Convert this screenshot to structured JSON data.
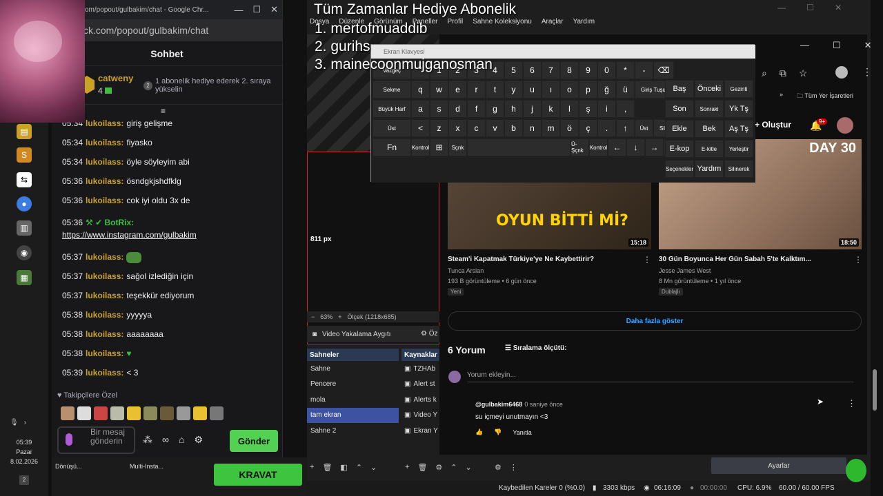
{
  "overlay": {
    "title": "Tüm Zamanlar Hediye  Abonelik",
    "lines": [
      "1. mertofmuaddib",
      "2. gurihs",
      "3. mainecoonmujganosman"
    ]
  },
  "chat_window": {
    "chrome_title": "om/popout/gulbakim/chat - Google Chr...",
    "url": "ck.com/popout/gulbakim/chat",
    "header": "Sohbet",
    "gift": {
      "user": "catweny",
      "count": "4",
      "rank": "2",
      "text": "1 abonelik hediye ederek 2. sıraya yükselin"
    },
    "messages": [
      {
        "time": "05:34",
        "user": "lukoilass:",
        "text": "giriş gelişme"
      },
      {
        "time": "05:34",
        "user": "lukoilass:",
        "text": "fiyasko"
      },
      {
        "time": "05:34",
        "user": "lukoilass:",
        "text": "öyle söyleyim abi"
      },
      {
        "time": "05:36",
        "user": "lukoilass:",
        "text": "ösndgkjshdfklg"
      },
      {
        "time": "05:36",
        "user": "lukoilass:",
        "text": "cok iyi oldu 3x de"
      },
      {
        "time": "05:36",
        "user": "BotRix:",
        "text": "https://www.instagram.com/gulbakim"
      },
      {
        "time": "05:37",
        "user": "lukoilass:",
        "text": ""
      },
      {
        "time": "05:37",
        "user": "lukoilass:",
        "text": "sağol izlediğin için"
      },
      {
        "time": "05:37",
        "user": "lukoilass:",
        "text": "teşekkür ediyorum"
      },
      {
        "time": "05:38",
        "user": "lukoilass:",
        "text": "yyyyya"
      },
      {
        "time": "05:38",
        "user": "lukoilass:",
        "text": "aaaaaaaa"
      },
      {
        "time": "05:38",
        "user": "lukoilass:",
        "text": "💚"
      },
      {
        "time": "05:39",
        "user": "lukoilass:",
        "text": "< 3"
      }
    ],
    "followers_label": "Takipçilere Özel",
    "input_placeholder": "Bir mesaj gönderin",
    "send_label": "Gönder"
  },
  "taskbar": {
    "time": "05:39",
    "day": "Pazar",
    "date": "8.02.2026",
    "badge": "2"
  },
  "bottom_strip": {
    "label1": "Dönüşü...",
    "label2": "Multi-Insta...",
    "kravat": "KRAVAT"
  },
  "obs": {
    "menu": [
      "Dosya",
      "Düzenle",
      "Görünüm",
      "Paneller",
      "Profil",
      "Sahne Koleksiyonu",
      "Araçlar",
      "Yardım"
    ],
    "px_label": "811 px",
    "zoom": "63%",
    "scale": "Ölçek (1218x685)",
    "props_label": "Video Yakalama Aygıtı",
    "props_button": "Öz",
    "scenes_title": "Sahneler",
    "scenes": [
      "Sahne",
      "Pencere",
      "mola",
      "tam ekran",
      "Sahne 2"
    ],
    "active_scene": "tam ekran",
    "sources_title": "Kaynaklar",
    "sources": [
      "TZHAb",
      "Alert st",
      "Alerts k",
      "Video Y",
      "Ekran Y"
    ],
    "settings": "Ayarlar",
    "status": {
      "dropped": "Kaybedilen Kareler 0 (%0.0)",
      "bitrate": "3303 kbps",
      "stream_time": "06:16:09",
      "rec_time": "00:00:00",
      "cpu": "CPU: 6.9%",
      "fps": "60.00 / 60.00 FPS"
    }
  },
  "keyboard": {
    "title": "Ekran Klavyesi",
    "rows": [
      [
        "Vazgeç",
        "\"",
        "1",
        "2",
        "3",
        "4",
        "5",
        "6",
        "7",
        "8",
        "9",
        "0",
        "*",
        "-",
        "⌫"
      ],
      [
        "Sekme",
        "q",
        "w",
        "e",
        "r",
        "t",
        "y",
        "u",
        "ı",
        "o",
        "p",
        "ğ",
        "ü",
        "Giriş Tuşu"
      ],
      [
        "Büyük Harf",
        "a",
        "s",
        "d",
        "f",
        "g",
        "h",
        "j",
        "k",
        "l",
        "ş",
        "i",
        ","
      ],
      [
        "Üst",
        "<",
        "z",
        "x",
        "c",
        "v",
        "b",
        "n",
        "m",
        "ö",
        "ç",
        ".",
        "↑",
        "Üst",
        "Sil"
      ],
      [
        "Fn",
        "Kontrol",
        "⊞",
        "Sçnk",
        "",
        "Ü-Şçnk",
        "Kontrol",
        "←",
        "↓",
        "→",
        "▤"
      ]
    ],
    "right": [
      [
        "Baş",
        "Önceki",
        "Gezinti"
      ],
      [
        "Son",
        "Sonraki",
        "Yk Tş"
      ],
      [
        "Ekle",
        "Bek",
        "Aş Tş"
      ],
      [
        "E-kop",
        "E-kitle",
        "Yerleştir"
      ],
      [
        "Seçenekler",
        "Yardım",
        "Silinerek"
      ]
    ]
  },
  "youtube": {
    "bookmarks": [
      "»",
      "Tüm Yer İşaretleri"
    ],
    "create": "Oluştur",
    "notif_count": "9+",
    "videos": [
      {
        "title": "Steam'i Kapatmak Türkiye'ye Ne Kaybettirir?",
        "channel": "Tunca Arslan",
        "meta": "193 B görüntüleme • 6 gün önce",
        "tag": "Yeni",
        "duration": "15:18",
        "thumb_text": "OYUN BİTTİ Mİ?"
      },
      {
        "title": "30 Gün Boyunca Her Gün Sabah 5'te Kalktım...",
        "channel": "Jesse James West",
        "meta": "8 Mn görüntüleme • 1 yıl önce",
        "tag": "Dublajlı",
        "duration": "18:50",
        "thumb_text": "DAY 30"
      }
    ],
    "more": "Daha fazla göster",
    "comments_count": "6 Yorum",
    "sort": "Sıralama ölçütü:",
    "add_comment": "Yorum ekleyin...",
    "comment": {
      "author": "@gulbakim6468",
      "time": "0 saniye önce",
      "text": "su içmeyi unutmayın <3",
      "reply": "Yanıtla"
    }
  }
}
